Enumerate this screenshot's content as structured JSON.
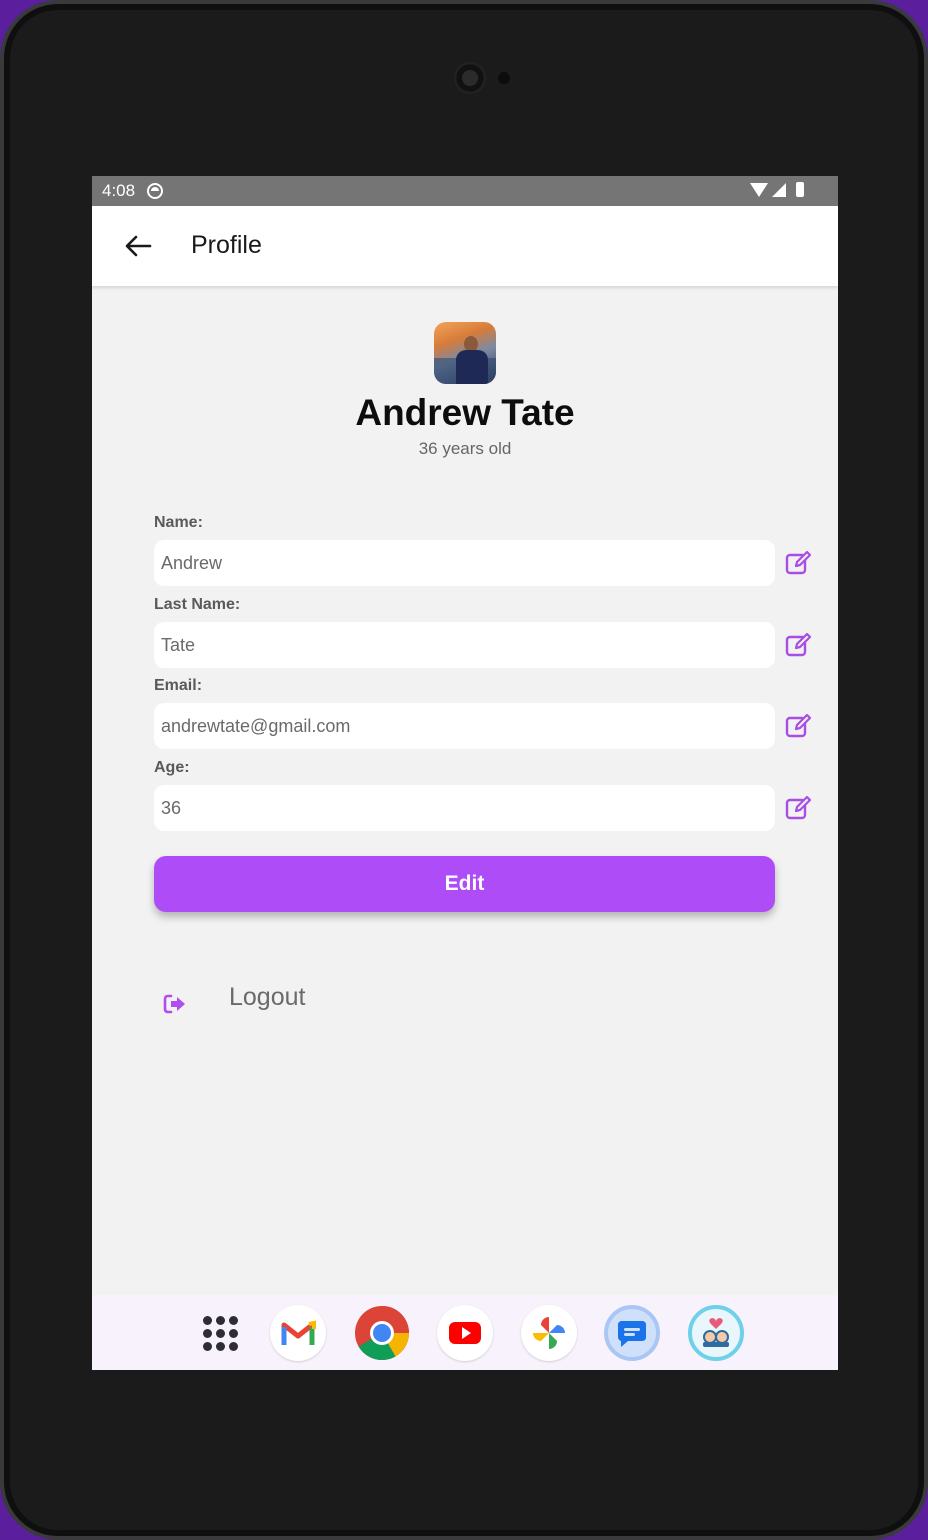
{
  "status_bar": {
    "time": "4:08"
  },
  "app_bar": {
    "title": "Profile"
  },
  "profile": {
    "name": "Andrew Tate",
    "age_text": "36 years old"
  },
  "form": {
    "fields": [
      {
        "label": "Name:",
        "value": "Andrew"
      },
      {
        "label": "Last Name:",
        "value": "Tate"
      },
      {
        "label": "Email:",
        "value": "andrewtate@gmail.com"
      },
      {
        "label": "Age:",
        "value": "36"
      }
    ],
    "edit_button_label": "Edit"
  },
  "logout": {
    "label": "Logout"
  },
  "dock": {
    "items": [
      "apps-grid-icon",
      "gmail-icon",
      "chrome-icon",
      "youtube-icon",
      "photos-icon",
      "messages-icon",
      "dating-app-icon"
    ]
  },
  "colors": {
    "accent": "#ae4cf8",
    "edit_icon": "#a84de6",
    "screen_bg": "#f2f2f2"
  }
}
